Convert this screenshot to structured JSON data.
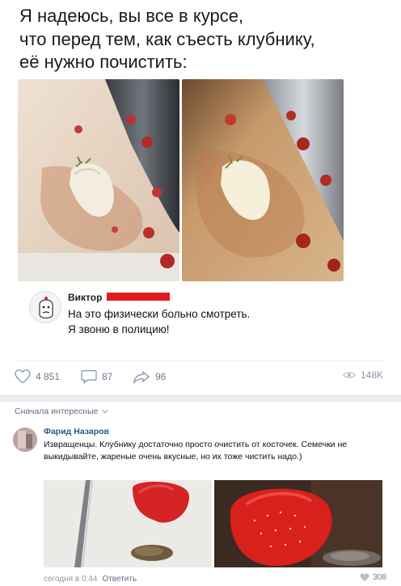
{
  "headline": [
    "Я надеюсь, вы все в курсе,",
    "что перед тем, как съесть клубнику,",
    "её нужно почистить:"
  ],
  "quote": {
    "name": "Виктор",
    "lines": [
      "На это физически больно смотреть.",
      "Я звоню в полицию!"
    ],
    "redaction_color": "#e01b1b"
  },
  "post_actions": {
    "likes": "4 851",
    "comments": "87",
    "shares": "96",
    "views": "148K"
  },
  "comments_section": {
    "sort_label": "Сначала интересные",
    "comment": {
      "author": "Фарид Назаров",
      "text": "Извращенцы. Клубнику достаточно просто очистить от косточек. Семечки не выкидывайте, жареные очень вкусные, но их тоже чистить надо.)",
      "timestamp": "сегодня в 0:44",
      "reply_label": "Ответить",
      "likes": "308"
    }
  },
  "icons": {
    "like": "heart-icon",
    "comment": "speech-bubble-icon",
    "share": "share-arrow-icon",
    "views": "eye-icon",
    "sort": "chevron-down-icon"
  },
  "colors": {
    "link": "#2a5885",
    "muted": "#6b7c8f",
    "divider": "#edeef0"
  }
}
